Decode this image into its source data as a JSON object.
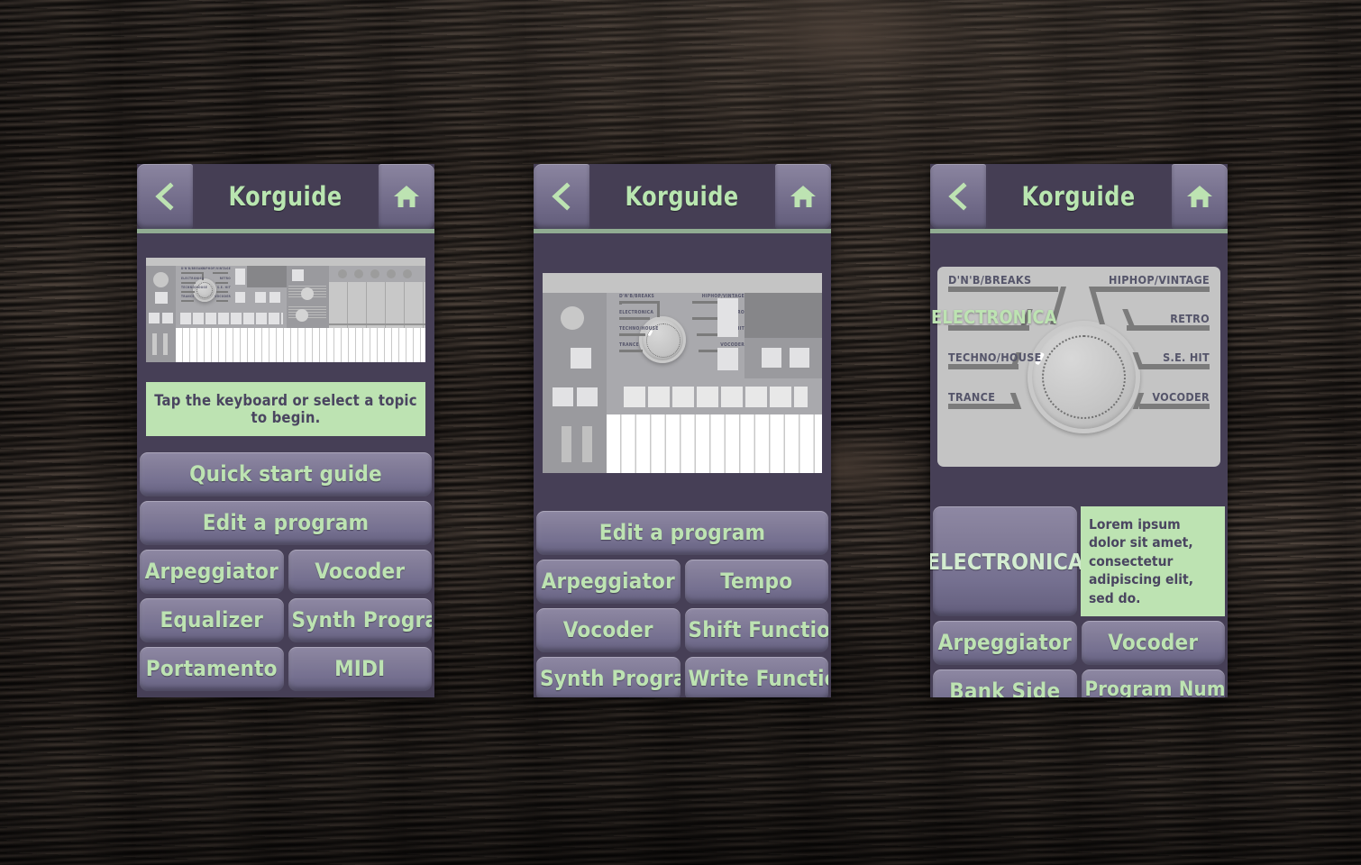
{
  "app": {
    "title": "Korguide",
    "back_icon": "chevron-left-icon",
    "home_icon": "home-icon",
    "accent_green": "#bde3b2",
    "panel_bg": "#463f56",
    "button_bg": "#7a7491",
    "title_bg": "#453e54",
    "underline_color": "#9fbf9c"
  },
  "knob_diagram": {
    "labels_left": [
      "D'N'B/BREAKS",
      "ELECTRONICA",
      "TECHNO/HOUSE",
      "TRANCE"
    ],
    "labels_right": [
      "HIPHOP/VINTAGE",
      "RETRO",
      "S.E. HIT",
      "VOCODER"
    ],
    "selected": "ELECTRONICA"
  },
  "panels": [
    {
      "id": "panel-1",
      "title": "Korguide",
      "hero": "korg-microkorg-full-device",
      "message": "Tap the keyboard or select a topic to begin.",
      "menu": [
        {
          "type": "full",
          "label": "Quick start guide"
        },
        {
          "type": "full",
          "label": "Edit a program"
        },
        {
          "type": "pair",
          "left": "Arpeggiator",
          "right": "Vocoder"
        },
        {
          "type": "pair",
          "left": "Equalizer",
          "right": "Synth Program"
        },
        {
          "type": "pair",
          "left": "Portamento",
          "right": "MIDI"
        }
      ]
    },
    {
      "id": "panel-2",
      "title": "Korguide",
      "hero": "korg-microkorg-zoomed-left",
      "menu": [
        {
          "type": "full",
          "label": "Edit a program"
        },
        {
          "type": "pair",
          "left": "Arpeggiator",
          "right": "Tempo"
        },
        {
          "type": "pair",
          "left": "Vocoder",
          "right": "Shift Function"
        },
        {
          "type": "pair",
          "left": "Synth Program",
          "right": "Write Function"
        }
      ]
    },
    {
      "id": "panel-3",
      "title": "Korguide",
      "hero": "korg-program-genre-knob",
      "topic": {
        "button_label": "ELECTRONICA",
        "description": "Lorem ipsum dolor sit amet, consectetur adipiscing elit, sed do."
      },
      "menu": [
        {
          "type": "pair",
          "left": "Arpeggiator",
          "right": "Vocoder"
        },
        {
          "type": "pair",
          "left": "Bank Side",
          "right": "Program Number"
        }
      ]
    }
  ]
}
